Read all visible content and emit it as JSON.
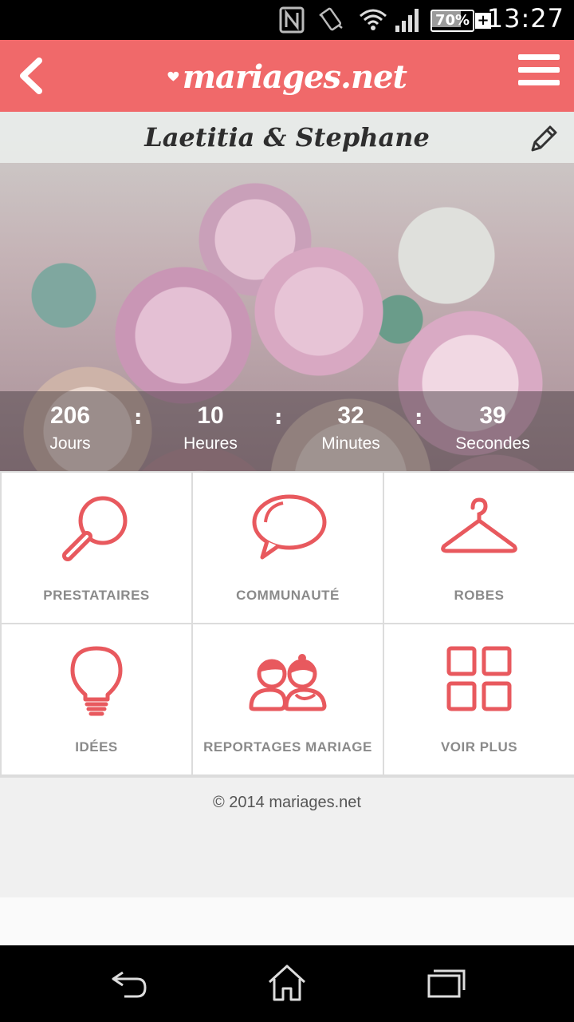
{
  "status_bar": {
    "time": "13:27",
    "battery_percent": "70%",
    "battery_level": 0.7,
    "icons": [
      "nfc-icon",
      "vibrate-icon",
      "wifi-icon",
      "signal-icon",
      "battery-icon",
      "charging-plus-icon"
    ]
  },
  "header": {
    "logo_text": "mariages.net",
    "back_icon": "chevron-left-icon",
    "menu_icon": "hamburger-menu-icon"
  },
  "hero": {
    "couple_name": "Laetitia & Stephane",
    "edit_icon": "pencil-icon",
    "countdown": [
      {
        "value": "206",
        "label": "Jours"
      },
      {
        "value": "10",
        "label": "Heures"
      },
      {
        "value": "32",
        "label": "Minutes"
      },
      {
        "value": "39",
        "label": "Secondes"
      }
    ],
    "separator": ":"
  },
  "tiles": [
    {
      "label": "PRESTATAIRES",
      "icon": "magnifier-icon"
    },
    {
      "label": "COMMUNAUTÉ",
      "icon": "speech-bubble-icon"
    },
    {
      "label": "ROBES",
      "icon": "hanger-icon"
    },
    {
      "label": "IDÉES",
      "icon": "lightbulb-icon"
    },
    {
      "label": "REPORTAGES MARIAGE",
      "icon": "couple-icon"
    },
    {
      "label": "VOIR PLUS",
      "icon": "grid-icon"
    }
  ],
  "footer": {
    "copyright": "© 2014 mariages.net"
  },
  "nav_bar": {
    "icons": [
      "back-icon",
      "home-icon",
      "recents-icon"
    ]
  },
  "colors": {
    "brand": "#f0696a",
    "icon_red": "#e8595e",
    "label_gray": "#8a8a8a"
  }
}
